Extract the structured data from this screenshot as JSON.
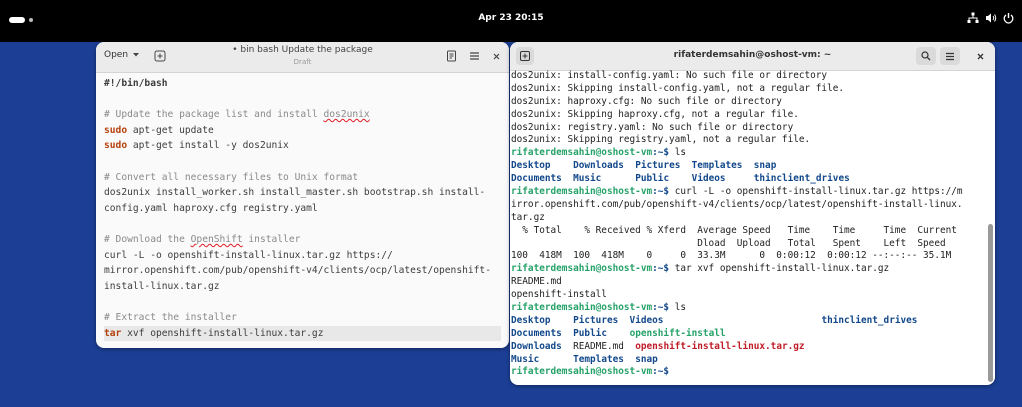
{
  "topbar": {
    "clock": "Apr 23  20:15"
  },
  "editor": {
    "open_label": "Open",
    "title": "• bin bash Update the package",
    "subtitle": "Draft",
    "lines": [
      "#!/bin/bash",
      "",
      "# Update the package list and install dos2unix",
      "sudo apt-get update",
      "sudo apt-get install -y dos2unix",
      "",
      "# Convert all necessary files to Unix format",
      "dos2unix install_worker.sh install_master.sh bootstrap.sh install-",
      "config.yaml haproxy.cfg registry.yaml",
      "",
      "# Download the OpenShift installer",
      "curl -L -o openshift-install-linux.tar.gz https://",
      "mirror.openshift.com/pub/openshift-v4/clients/ocp/latest/openshift-",
      "install-linux.tar.gz",
      "",
      "# Extract the installer",
      "tar xvf openshift-install-linux.tar.gz"
    ]
  },
  "terminal": {
    "title": "rifaterdemsahin@oshost-vm: ~",
    "prompt_user": "rifaterdemsahin@oshost-vm",
    "prompt_path": ":~$",
    "lines": {
      "l1": "dos2unix: install-config.yaml: No such file or directory",
      "l2": "dos2unix: Skipping install-config.yaml, not a regular file.",
      "l3": "dos2unix: haproxy.cfg: No such file or directory",
      "l4": "dos2unix: Skipping haproxy.cfg, not a regular file.",
      "l5": "dos2unix: registry.yaml: No such file or directory",
      "l6": "dos2unix: Skipping registry.yaml, not a regular file.",
      "cmd_ls1": " ls",
      "ls1_row1": [
        "Desktop",
        "Downloads",
        "Pictures",
        "Templates",
        "snap"
      ],
      "ls1_row2": [
        "Documents",
        "Music",
        "Public",
        "Videos",
        "thinclient_drives"
      ],
      "cmd_curl": " curl -L -o openshift-install-linux.tar.gz https://m",
      "curl_wrap1": "irror.openshift.com/pub/openshift-v4/clients/ocp/latest/openshift-install-linux.",
      "curl_wrap2": "tar.gz",
      "curl_hdr1": "  % Total    % Received % Xferd  Average Speed   Time    Time     Time  Current",
      "curl_hdr2": "                                 Dload  Upload   Total   Spent    Left  Speed",
      "curl_prog": "100  418M  100  418M    0     0  33.3M      0  0:00:12  0:00:12 --:--:-- 35.1M",
      "cmd_tar": " tar xvf openshift-install-linux.tar.gz",
      "tar_out1": "README.md",
      "tar_out2": "openshift-install",
      "cmd_ls2": " ls",
      "ls2_row1": [
        "Desktop",
        "Pictures",
        "Videos",
        "thinclient_drives"
      ],
      "ls2_row2": [
        "Documents",
        "Public",
        "openshift-install"
      ],
      "ls2_row3": [
        "Downloads",
        "README.md",
        "openshift-install-linux.tar.gz"
      ],
      "ls2_row4": [
        "Music",
        "Templates",
        "snap"
      ]
    }
  },
  "colors": {
    "desktop": "#1c3f95",
    "prompt_green": "#26a269",
    "dir_blue": "#12488b",
    "archive_red": "#c01c28",
    "keyword_orange": "#b5400b"
  }
}
